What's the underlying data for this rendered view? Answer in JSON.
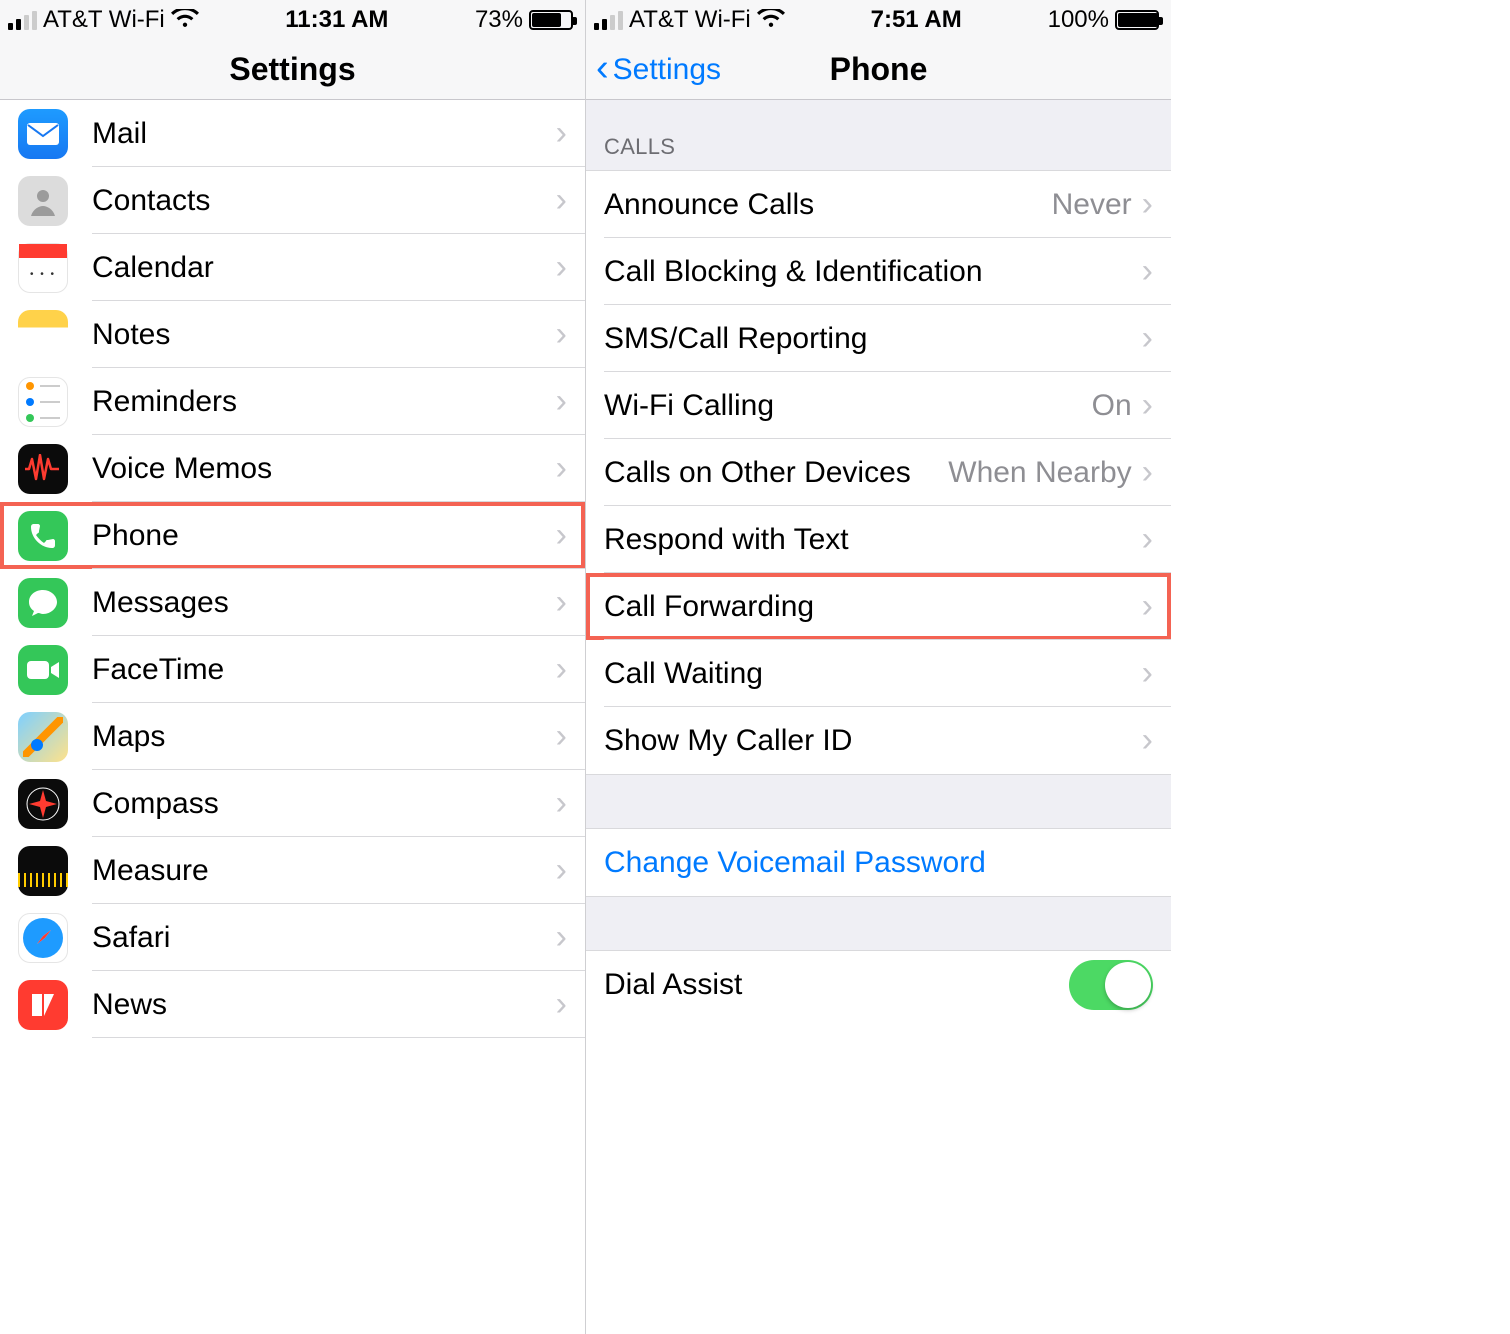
{
  "left": {
    "status": {
      "carrier": "AT&T Wi-Fi",
      "time": "11:31 AM",
      "battery_pct": "73%",
      "battery_fill": 73
    },
    "nav": {
      "title": "Settings"
    },
    "items": [
      {
        "id": "mail",
        "label": "Mail"
      },
      {
        "id": "contacts",
        "label": "Contacts"
      },
      {
        "id": "calendar",
        "label": "Calendar"
      },
      {
        "id": "notes",
        "label": "Notes"
      },
      {
        "id": "reminders",
        "label": "Reminders"
      },
      {
        "id": "voicememos",
        "label": "Voice Memos"
      },
      {
        "id": "phone",
        "label": "Phone",
        "highlight": true
      },
      {
        "id": "messages",
        "label": "Messages"
      },
      {
        "id": "facetime",
        "label": "FaceTime"
      },
      {
        "id": "maps",
        "label": "Maps"
      },
      {
        "id": "compass",
        "label": "Compass"
      },
      {
        "id": "measure",
        "label": "Measure"
      },
      {
        "id": "safari",
        "label": "Safari"
      },
      {
        "id": "news",
        "label": "News"
      }
    ]
  },
  "right": {
    "status": {
      "carrier": "AT&T Wi-Fi",
      "time": "7:51 AM",
      "battery_pct": "100%",
      "battery_fill": 100
    },
    "nav": {
      "back": "Settings",
      "title": "Phone"
    },
    "section_calls": "Calls",
    "items": [
      {
        "id": "announce",
        "label": "Announce Calls",
        "value": "Never"
      },
      {
        "id": "blocking",
        "label": "Call Blocking & Identification"
      },
      {
        "id": "smsreport",
        "label": "SMS/Call Reporting"
      },
      {
        "id": "wificalling",
        "label": "Wi-Fi Calling",
        "value": "On"
      },
      {
        "id": "otherdev",
        "label": "Calls on Other Devices",
        "value": "When Nearby"
      },
      {
        "id": "respondtext",
        "label": "Respond with Text"
      },
      {
        "id": "forwarding",
        "label": "Call Forwarding",
        "highlight": true
      },
      {
        "id": "waiting",
        "label": "Call Waiting"
      },
      {
        "id": "callerid",
        "label": "Show My Caller ID"
      }
    ],
    "voicemail_link": "Change Voicemail Password",
    "dial_assist": {
      "label": "Dial Assist",
      "on": true
    }
  }
}
